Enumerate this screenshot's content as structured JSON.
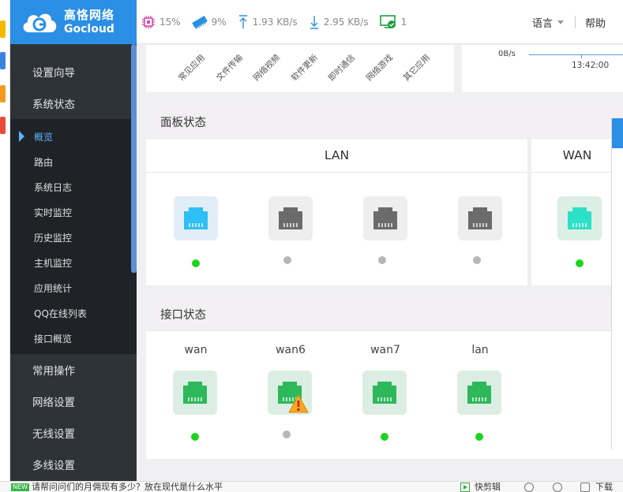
{
  "logo": {
    "name_cn": "高恪网络",
    "name_en": "Gocloud"
  },
  "status": {
    "cpu": "15%",
    "memory": "9%",
    "upload": "1.93 KB/s",
    "download": "2.95 KB/s",
    "online_hosts": "1"
  },
  "topbar": {
    "language": "语言",
    "help": "帮助"
  },
  "sidebar": {
    "items": [
      {
        "label": "设置向导"
      },
      {
        "label": "系统状态"
      }
    ],
    "submenu": [
      {
        "label": "概览",
        "active": true
      },
      {
        "label": "路由"
      },
      {
        "label": "系统日志"
      },
      {
        "label": "实时监控"
      },
      {
        "label": "历史监控"
      },
      {
        "label": "主机监控"
      },
      {
        "label": "应用统计"
      },
      {
        "label": "QQ在线列表"
      },
      {
        "label": "接口概览"
      }
    ],
    "items_after": [
      {
        "label": "常用操作"
      },
      {
        "label": "网络设置"
      },
      {
        "label": "无线设置"
      },
      {
        "label": "多线设置"
      }
    ]
  },
  "app_chart": {
    "categories": [
      "常见应用",
      "文件传输",
      "网络视频",
      "软件更新",
      "即时通信",
      "网络游戏",
      "其它应用"
    ]
  },
  "traffic_chart": {
    "y_tick": "0B/s",
    "x_tick": "13:42:00"
  },
  "panel": {
    "title": "面板状态",
    "lan_label": "LAN",
    "wan_label": "WAN",
    "lan_ports": [
      {
        "status": "up",
        "color": "#2dbff5"
      },
      {
        "status": "off",
        "color": "#6b6b6b"
      },
      {
        "status": "off",
        "color": "#6b6b6b"
      },
      {
        "status": "off",
        "color": "#6b6b6b"
      }
    ],
    "wan_ports": [
      {
        "status": "up",
        "color": "#2de0c8"
      }
    ]
  },
  "interfaces": {
    "title": "接口状态",
    "items": [
      {
        "name": "wan",
        "status": "up",
        "warning": false
      },
      {
        "name": "wan6",
        "status": "down",
        "warning": true
      },
      {
        "name": "wan7",
        "status": "up",
        "warning": false
      },
      {
        "name": "lan",
        "status": "up",
        "warning": false
      }
    ]
  },
  "bottombar": {
    "badge": "NEW",
    "news": "请帮问问们的月佣现有多少？放在现代是什么水平",
    "clip_label": "快剪辑",
    "download_label": "下载"
  },
  "colors": {
    "brand": "#2b8fe6",
    "sidebar_bg": "#2e3338",
    "submenu_bg": "#1f2226",
    "active_nav": "#5ab4ff",
    "port_green": "#2db85a",
    "status_green": "#1dd41d",
    "status_gray": "#b6b6b6"
  }
}
